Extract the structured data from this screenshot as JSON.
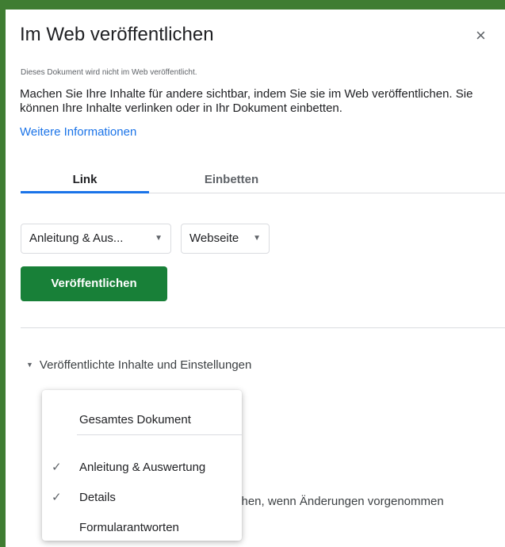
{
  "dialog": {
    "title": "Im Web veröffentlichen",
    "close_glyph": "×",
    "status": "Dieses Dokument wird nicht im Web veröffentlicht.",
    "description": "Machen Sie Ihre Inhalte für andere sichtbar, indem Sie sie im Web veröffentlichen. Sie können Ihre Inhalte verlinken oder in Ihr Dokument einbetten.",
    "more_link": "Weitere Informationen"
  },
  "tabs": [
    {
      "label": "Link",
      "active": true
    },
    {
      "label": "Einbetten",
      "active": false
    }
  ],
  "selects": {
    "sheet": "Anleitung & Aus...",
    "format": "Webseite"
  },
  "publish_button": "Veröffentlichen",
  "settings_section": {
    "label": "Veröffentlichte Inhalte und Einstellungen",
    "partial_text": "chen, wenn Änderungen vorgenommen"
  },
  "menu": {
    "items": [
      {
        "label": "Gesamtes Dokument",
        "checked": false
      },
      {
        "label": "Anleitung & Auswertung",
        "checked": true
      },
      {
        "label": "Details",
        "checked": true
      },
      {
        "label": "Formularantworten",
        "checked": false
      }
    ],
    "check_glyph": "✓"
  },
  "colors": {
    "accent": "#1a73e8",
    "publish_green": "#188038",
    "frame_green": "#3f7d32"
  }
}
